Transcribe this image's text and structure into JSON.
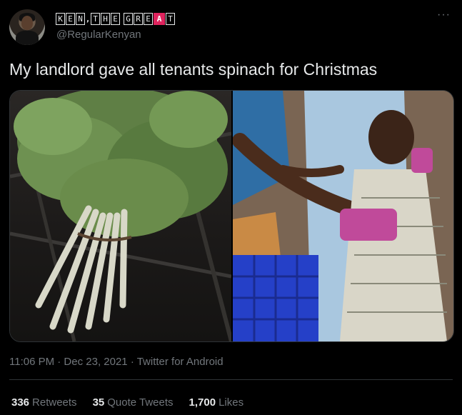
{
  "tweet": {
    "display_name_tiles": [
      "K",
      "E",
      "N",
      ",",
      "T",
      "H",
      "E",
      "G",
      "R",
      "E",
      "A",
      "T"
    ],
    "handle": "@RegularKenyan",
    "text": "My landlord gave all tenants spinach for Christmas",
    "timestamp": "11:06 PM · Dec 23, 2021 · Twitter for Android",
    "stats": {
      "retweets_count": "336",
      "retweets_label": "Retweets",
      "quote_count": "35",
      "quote_label": "Quote Tweets",
      "likes_count": "1,700",
      "likes_label": "Likes"
    },
    "more_icon": "more-horizontal-icon"
  },
  "colors": {
    "background": "#000000",
    "text_primary": "#e7e9ea",
    "text_secondary": "#71767b",
    "divider": "#2f3336",
    "accent_red": "#e0245e"
  }
}
